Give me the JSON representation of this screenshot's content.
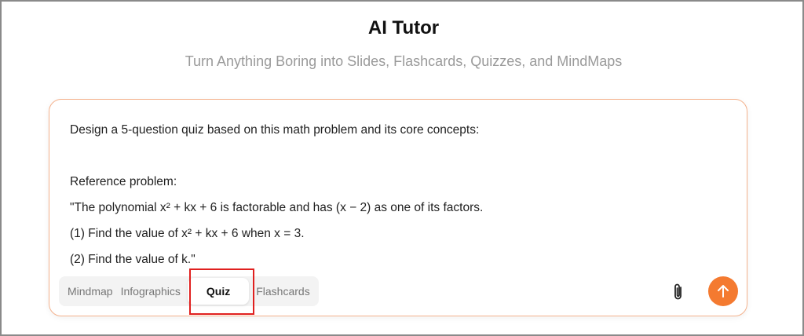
{
  "header": {
    "title": "AI Tutor",
    "subtitle": "Turn Anything Boring into Slides, Flashcards, Quizzes, and MindMaps"
  },
  "prompt": {
    "lines": [
      "Design a 5-question quiz based on this math problem and its core concepts:",
      "",
      "Reference problem:",
      "\"The polynomial x² + kx + 6 is factorable and has (x − 2) as one of its factors.",
      "(1) Find the value of x² + kx + 6 when x = 3.",
      "(2) Find the value of k.\""
    ]
  },
  "modes": {
    "items": [
      "Mindmap",
      "Infographics",
      "Quiz",
      "Flashcards"
    ],
    "selected": "Quiz"
  },
  "icons": {
    "attach": "paperclip-icon",
    "send": "arrow-up-icon"
  },
  "colors": {
    "accent": "#f47a30",
    "card_border": "#f4b28d",
    "highlight": "#e0201f"
  }
}
